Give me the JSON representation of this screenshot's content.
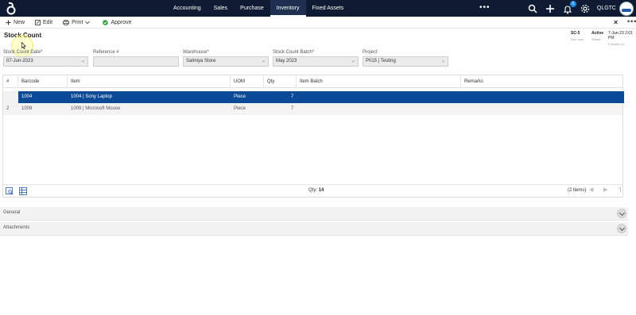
{
  "nav": {
    "items": [
      "Accounting",
      "Sales",
      "Purchase",
      "Inventory",
      "Fixed Assets"
    ],
    "more": "•••",
    "user": "QLGTC",
    "notification_count": "0"
  },
  "toolbar": {
    "new_label": "New",
    "edit_label": "Edit",
    "print_label": "Print",
    "approve_label": "Approve",
    "close_label": "×",
    "more_label": "•••"
  },
  "page": {
    "title": "Stock Count"
  },
  "status": {
    "doc_no": "SC-5",
    "doc_no_label": "Doc num",
    "state": "Active",
    "state_label": "Status",
    "created": "7-Jun-23 2:01 PM",
    "created_label": "Created on"
  },
  "form": {
    "date_label": "Stock Count Date*",
    "date_value": "07-Jun-2023",
    "ref_label": "Reference #",
    "ref_value": "",
    "warehouse_label": "Warehouse*",
    "warehouse_value": "Salmiya Store",
    "batch_label": "Stock Count Batch*",
    "batch_value": "May 2023",
    "project_label": "Project",
    "project_value": "P015 | Testing"
  },
  "grid": {
    "columns": [
      "#",
      "Barcode",
      "Item",
      "UOM",
      "Qty",
      "Item Batch",
      "Remarks"
    ],
    "rows": [
      {
        "num": "",
        "barcode": "1004",
        "item": "1004 | Sony Laptop",
        "uom": "Piece",
        "qty": "7",
        "batch": "",
        "remarks": ""
      },
      {
        "num": "2",
        "barcode": "1009",
        "item": "1009 | Microsoft Mouse",
        "uom": "Piece",
        "qty": "7",
        "batch": "",
        "remarks": ""
      }
    ],
    "qty_label": "Qty:",
    "qty_total": "14",
    "items_count": "(2 items)"
  },
  "sections": {
    "general": "General",
    "attachments": "Attachments"
  },
  "colors": {
    "topbar": "#0e1b33",
    "selected_row": "#0b4a97",
    "approve_icon": "#2e9e3e"
  }
}
